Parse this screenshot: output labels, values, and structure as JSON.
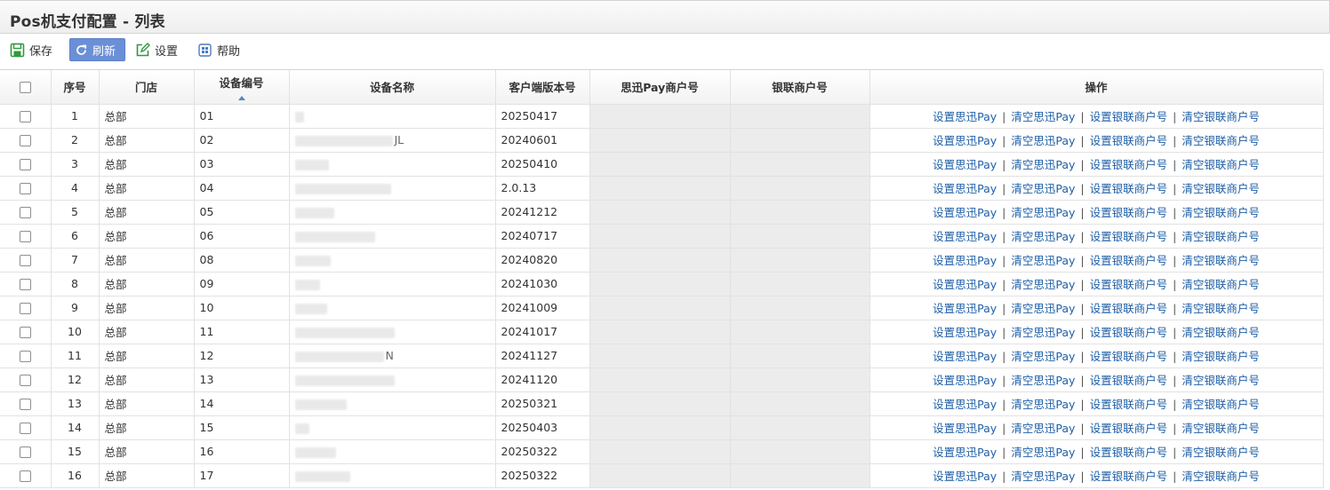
{
  "page": {
    "title": "Pos机支付配置 - 列表"
  },
  "toolbar": {
    "save": "保存",
    "refresh": "刷新",
    "settings": "设置",
    "help": "帮助"
  },
  "table": {
    "headers": {
      "seq": "序号",
      "store": "门店",
      "device_code": "设备编号",
      "device_name": "设备名称",
      "client_version": "客户端版本号",
      "sixun_pay_merchant": "思迅Pay商户号",
      "unionpay_merchant": "银联商户号",
      "ops": "操作"
    },
    "ops": {
      "set_sixun": "设置思迅Pay",
      "clear_sixun": "清空思迅Pay",
      "set_union": "设置银联商户号",
      "clear_union": "清空银联商户号",
      "sep": "|"
    },
    "rows": [
      {
        "seq": "1",
        "store": "总部",
        "code": "01",
        "name_suffix": "",
        "version": "20250417"
      },
      {
        "seq": "2",
        "store": "总部",
        "code": "02",
        "name_suffix": "JL",
        "version": "20240601"
      },
      {
        "seq": "3",
        "store": "总部",
        "code": "03",
        "name_suffix": "",
        "version": "20250410"
      },
      {
        "seq": "4",
        "store": "总部",
        "code": "04",
        "name_suffix": "",
        "version": "2.0.13"
      },
      {
        "seq": "5",
        "store": "总部",
        "code": "05",
        "name_suffix": "",
        "version": "20241212"
      },
      {
        "seq": "6",
        "store": "总部",
        "code": "06",
        "name_suffix": "",
        "version": "20240717"
      },
      {
        "seq": "7",
        "store": "总部",
        "code": "08",
        "name_suffix": "",
        "version": "20240820"
      },
      {
        "seq": "8",
        "store": "总部",
        "code": "09",
        "name_suffix": "",
        "version": "20241030"
      },
      {
        "seq": "9",
        "store": "总部",
        "code": "10",
        "name_suffix": "",
        "version": "20241009"
      },
      {
        "seq": "10",
        "store": "总部",
        "code": "11",
        "name_suffix": "",
        "version": "20241017"
      },
      {
        "seq": "11",
        "store": "总部",
        "code": "12",
        "name_suffix": "N",
        "version": "20241127"
      },
      {
        "seq": "12",
        "store": "总部",
        "code": "13",
        "name_suffix": "",
        "version": "20241120"
      },
      {
        "seq": "13",
        "store": "总部",
        "code": "14",
        "name_suffix": "",
        "version": "20250321"
      },
      {
        "seq": "14",
        "store": "总部",
        "code": "15",
        "name_suffix": "",
        "version": "20250403"
      },
      {
        "seq": "15",
        "store": "总部",
        "code": "16",
        "name_suffix": "",
        "version": "20250322"
      },
      {
        "seq": "16",
        "store": "总部",
        "code": "17",
        "name_suffix": "",
        "version": "20250322"
      }
    ]
  },
  "colors": {
    "link": "#1f5fa6",
    "active_button": "#6b8fd6",
    "merchant_cell": "#ececec",
    "save_icon": "#2e9a3e"
  }
}
